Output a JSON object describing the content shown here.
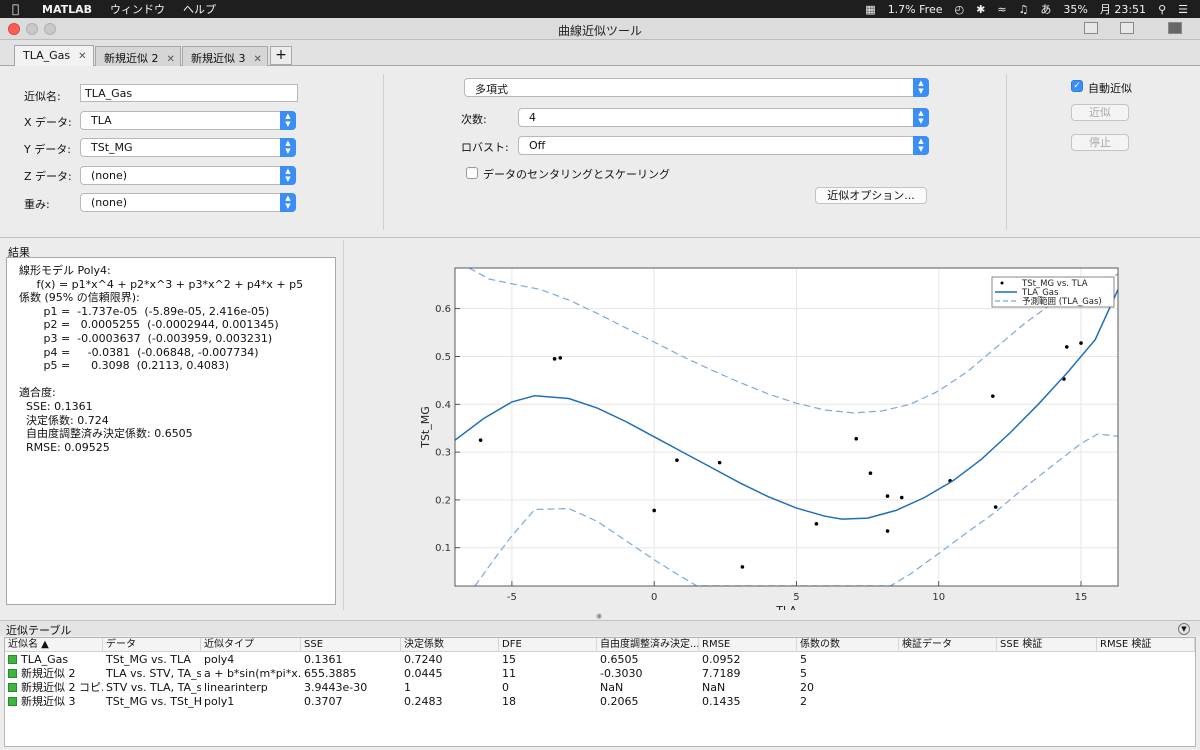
{
  "menubar": {
    "app": "MATLAB",
    "items": [
      "ウィンドウ",
      "ヘルプ"
    ],
    "status": {
      "memory": "1.7% Free",
      "input_method": "あ",
      "battery": "35%",
      "clock": "月 23:51"
    }
  },
  "window": {
    "title": "曲線近似ツール"
  },
  "tabs": [
    {
      "label": "TLA_Gas",
      "active": true
    },
    {
      "label": "新規近似 2",
      "active": false
    },
    {
      "label": "新規近似 3",
      "active": false
    }
  ],
  "tab_add_label": "+",
  "tab_close_glyph": "✕",
  "settings": {
    "fit_name_label": "近似名:",
    "fit_name_value": "TLA_Gas",
    "x_label": "X データ:",
    "x_value": "TLA",
    "y_label": "Y データ:",
    "y_value": "TSt_MG",
    "z_label": "Z データ:",
    "z_value": "(none)",
    "weights_label": "重み:",
    "weights_value": "(none)",
    "fit_type_value": "多項式",
    "degree_label": "次数:",
    "degree_value": "4",
    "robust_label": "ロバスト:",
    "robust_value": "Off",
    "center_scale_label": "データのセンタリングとスケーリング",
    "center_scale_checked": false,
    "fit_options_button": "近似オプション...",
    "auto_fit_label": "自動近似",
    "auto_fit_checked": true,
    "fit_button": "近似",
    "stop_button": "停止"
  },
  "results": {
    "label": "結果",
    "lines": [
      "線形モデル Poly4:",
      "     f(x) = p1*x^4 + p2*x^3 + p3*x^2 + p4*x + p5",
      "係数 (95% の信頼限界):",
      "       p1 =  -1.737e-05  (-5.89e-05, 2.416e-05)",
      "       p2 =   0.0005255  (-0.0002944, 0.001345)",
      "       p3 =  -0.0003637  (-0.003959, 0.003231)",
      "       p4 =     -0.0381  (-0.06848, -0.007734)",
      "       p5 =      0.3098  (0.2113, 0.4083)",
      "",
      "適合度:",
      "  SSE: 0.1361",
      "  決定係数: 0.724",
      "  自由度調整済み決定係数: 0.6505",
      "  RMSE: 0.09525"
    ]
  },
  "chart_data": {
    "type": "scatter",
    "xlabel": "TLA",
    "ylabel": "TSt_MG",
    "xlim": [
      -7,
      16.3
    ],
    "ylim": [
      0.02,
      0.685
    ],
    "xticks": [
      -5,
      0,
      5,
      10,
      15
    ],
    "yticks": [
      0.1,
      0.2,
      0.3,
      0.4,
      0.5,
      0.6
    ],
    "grid": true,
    "legend_position": "top-right",
    "colors": {
      "data": "#000000",
      "fit": "#1f6fb8",
      "bounds": "#7ba9dc"
    },
    "series": [
      {
        "name": "TSt_MG vs. TLA",
        "kind": "points",
        "x": [
          -6.1,
          -3.5,
          -3.3,
          0.0,
          0.8,
          2.3,
          3.1,
          5.7,
          7.1,
          7.6,
          8.2,
          8.2,
          8.7,
          10.4,
          11.9,
          12.0,
          14.4,
          14.5,
          15.0
        ],
        "y": [
          0.325,
          0.495,
          0.497,
          0.178,
          0.283,
          0.278,
          0.06,
          0.15,
          0.328,
          0.256,
          0.208,
          0.135,
          0.205,
          0.24,
          0.417,
          0.185,
          0.453,
          0.52,
          0.528
        ]
      },
      {
        "name": "TLA_Gas",
        "kind": "line",
        "x": [
          -7.0,
          -6.0,
          -5.0,
          -4.2,
          -3.0,
          -2.0,
          -1.0,
          0.0,
          1.0,
          2.0,
          3.0,
          4.0,
          5.0,
          6.0,
          6.6,
          7.5,
          8.5,
          9.5,
          10.5,
          11.5,
          12.5,
          13.5,
          14.5,
          15.5,
          16.3
        ],
        "y": [
          0.325,
          0.37,
          0.405,
          0.418,
          0.412,
          0.392,
          0.364,
          0.332,
          0.3,
          0.268,
          0.236,
          0.207,
          0.183,
          0.166,
          0.16,
          0.162,
          0.178,
          0.205,
          0.24,
          0.285,
          0.34,
          0.4,
          0.465,
          0.535,
          0.64
        ]
      },
      {
        "name": "予測範囲 (TLA_Gas)",
        "kind": "dashed",
        "x": [
          -6.5,
          -5.8,
          -5.0,
          -4.0,
          -3.0,
          -2.0,
          -1.0,
          0.0,
          1.0,
          2.0,
          3.0,
          4.0,
          5.0,
          6.0,
          7.0,
          8.0,
          9.0,
          10.0,
          11.0,
          12.0,
          13.0,
          14.0,
          15.0,
          16.3
        ],
        "y": [
          0.685,
          0.662,
          0.652,
          0.64,
          0.618,
          0.59,
          0.56,
          0.53,
          0.5,
          0.472,
          0.446,
          0.422,
          0.402,
          0.388,
          0.382,
          0.386,
          0.4,
          0.428,
          0.468,
          0.518,
          0.568,
          0.612,
          0.64,
          0.672
        ]
      },
      {
        "name": "",
        "kind": "dashed",
        "x": [
          -6.3,
          -5.5,
          -5.0,
          -4.2,
          -3.0,
          -2.0,
          -1.0,
          0.0,
          0.8,
          1.5,
          8.3,
          9.0,
          10.0,
          11.0,
          12.0,
          13.0,
          14.0,
          15.0,
          15.6,
          16.3
        ],
        "y": [
          0.02,
          0.086,
          0.125,
          0.18,
          0.182,
          0.155,
          0.115,
          0.075,
          0.045,
          0.02,
          0.02,
          0.045,
          0.088,
          0.132,
          0.175,
          0.225,
          0.272,
          0.318,
          0.338,
          0.333
        ]
      }
    ]
  },
  "fit_table": {
    "title": "近似テーブル",
    "collapse_glyph": "▼",
    "columns": [
      "近似名 ▲",
      "データ",
      "近似タイプ",
      "SSE",
      "決定係数",
      "DFE",
      "自由度調整済み決定...",
      "RMSE",
      "係数の数",
      "検証データ",
      "SSE 検証",
      "RMSE 検証"
    ],
    "rows": [
      [
        "TLA_Gas",
        "TSt_MG vs. TLA",
        "poly4",
        "0.1361",
        "0.7240",
        "15",
        "0.6505",
        "0.0952",
        "5",
        "",
        "",
        ""
      ],
      [
        "新規近似 2",
        "TLA vs. STV, TA_s...",
        "a + b*sin(m*pi*x...",
        "655.3885",
        "0.0445",
        "11",
        "-0.3030",
        "7.7189",
        "5",
        "",
        "",
        ""
      ],
      [
        "新規近似 2 コピ...",
        "STV vs. TLA, TA_s...",
        "linearinterp",
        "3.9443e-30",
        "1",
        "0",
        "NaN",
        "NaN",
        "20",
        "",
        "",
        ""
      ],
      [
        "新規近似 3",
        "TSt_MG vs. TSt_H...",
        "poly1",
        "0.3707",
        "0.2483",
        "18",
        "0.2065",
        "0.1435",
        "2",
        "",
        "",
        ""
      ]
    ]
  }
}
